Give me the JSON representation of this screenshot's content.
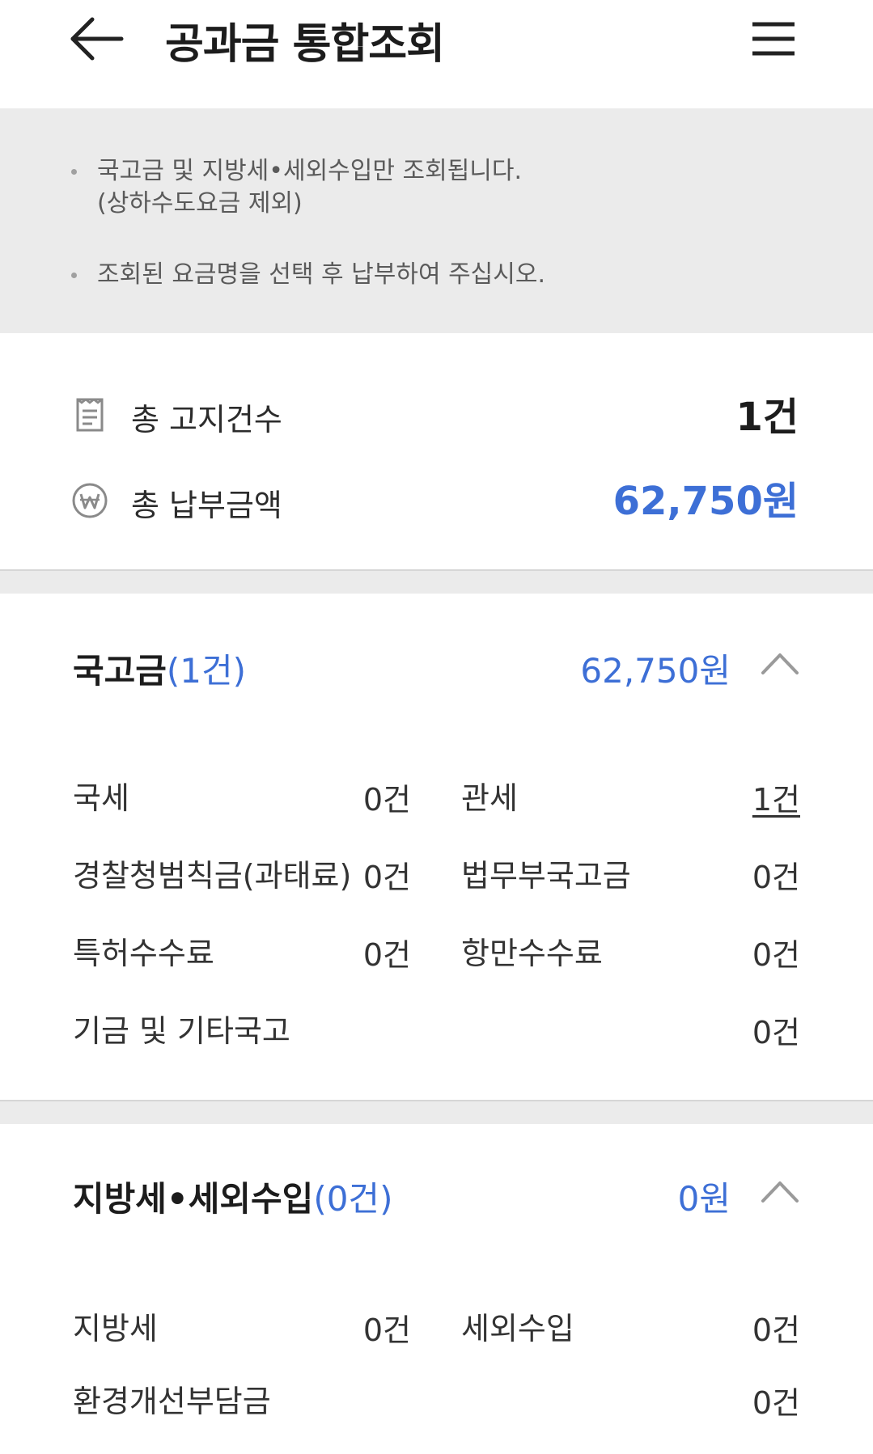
{
  "header": {
    "title": "공과금 통합조회"
  },
  "notice": {
    "items": [
      "국고금 및 지방세•세외수입만 조회됩니다.\n(상하수도요금 제외)",
      "조회된 요금명을 선택 후 납부하여 주십시오."
    ]
  },
  "summary": {
    "total_count_label": "총 고지건수",
    "total_count_value": "1건",
    "total_amount_label": "총 납부금액",
    "total_amount_value": "62,750원"
  },
  "sections": [
    {
      "title": "국고금",
      "count": "(1건)",
      "amount": "62,750원",
      "items": [
        {
          "label": "국세",
          "count": "0건"
        },
        {
          "label": "관세",
          "count": "1건"
        },
        {
          "label": "경찰청범칙금(과태료)",
          "count": "0건"
        },
        {
          "label": "법무부국고금",
          "count": "0건"
        },
        {
          "label": "특허수수료",
          "count": "0건"
        },
        {
          "label": "항만수수료",
          "count": "0건"
        },
        {
          "label": "기금 및 기타국고",
          "count": "0건"
        }
      ]
    },
    {
      "title": "지방세•세외수입",
      "count": "(0건)",
      "amount": "0원",
      "items": [
        {
          "label": "지방세",
          "count": "0건"
        },
        {
          "label": "세외수입",
          "count": "0건"
        },
        {
          "label": "환경개선부담금",
          "count": "0건"
        }
      ]
    }
  ],
  "colors": {
    "accent": "#3d6fd6",
    "notice_bg": "#ebebeb",
    "text": "#222222"
  },
  "icons": [
    "back-arrow-icon",
    "hamburger-menu-icon",
    "receipt-icon",
    "won-coin-icon",
    "chevron-up-icon"
  ]
}
